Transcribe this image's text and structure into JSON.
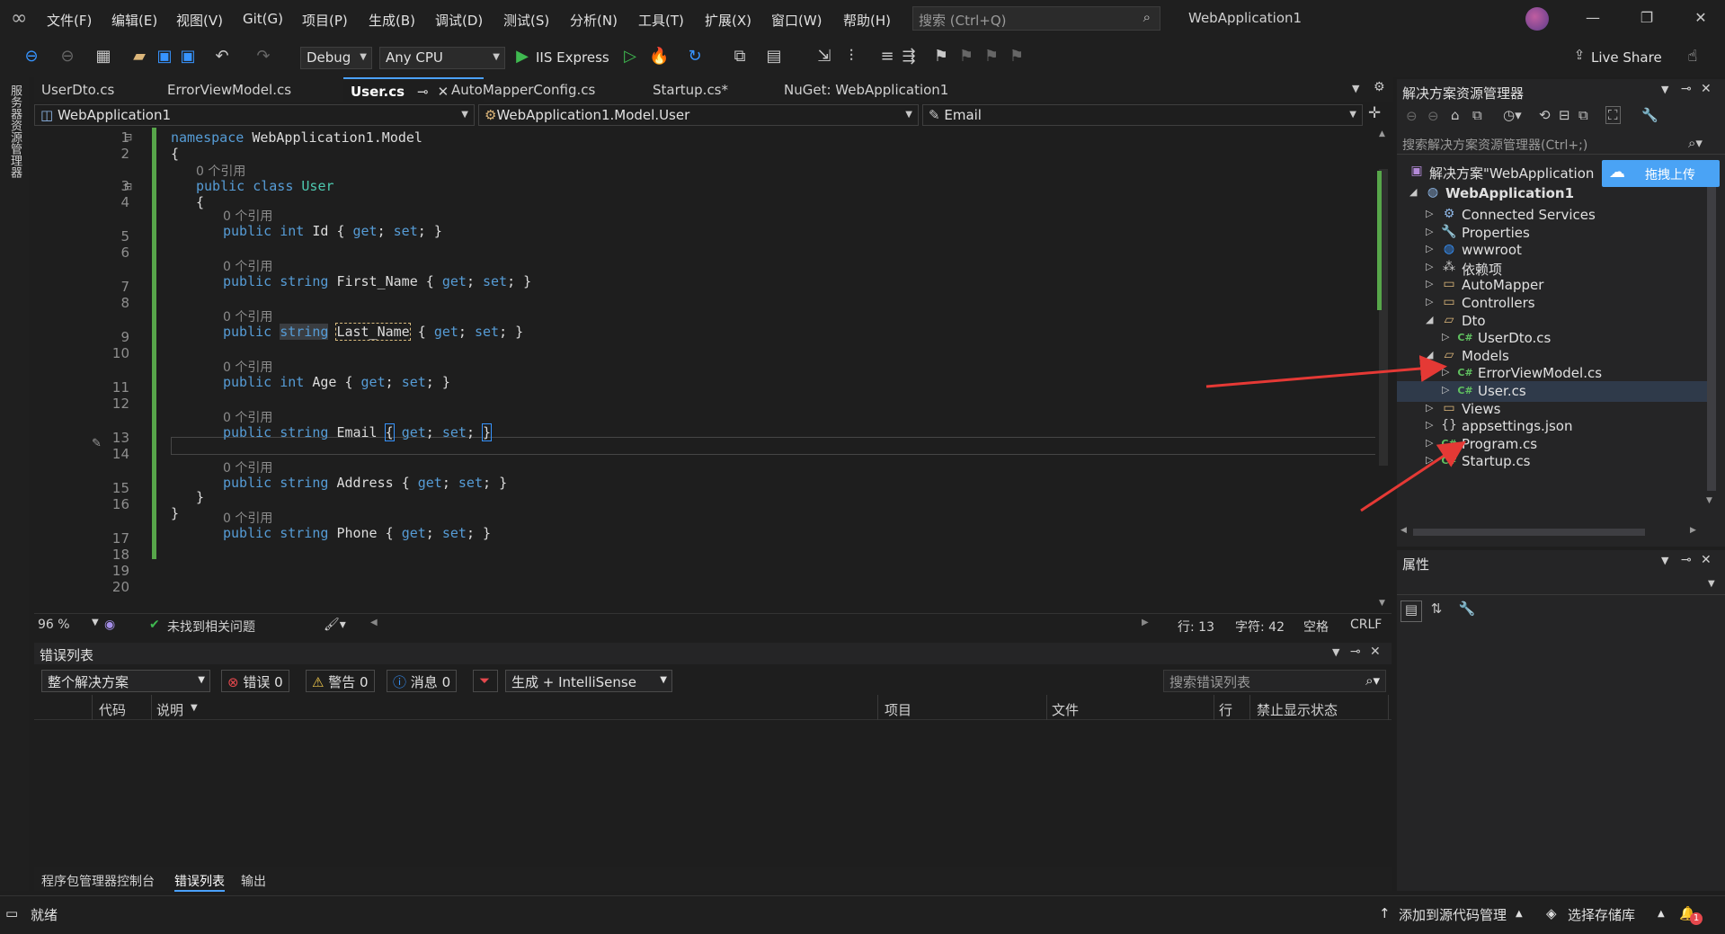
{
  "menubar": {
    "items": [
      "文件(F)",
      "编辑(E)",
      "视图(V)",
      "Git(G)",
      "项目(P)",
      "生成(B)",
      "调试(D)",
      "测试(S)",
      "分析(N)",
      "工具(T)",
      "扩展(X)",
      "窗口(W)",
      "帮助(H)"
    ],
    "search_placeholder": "搜索 (Ctrl+Q)",
    "app_title": "WebApplication1"
  },
  "toolbar": {
    "config": "Debug",
    "platform": "Any CPU",
    "run_label": "IIS Express",
    "live_share": "Live Share"
  },
  "left_strip": {
    "label": "服务器资源管理器"
  },
  "tabs": [
    {
      "label": "UserDto.cs",
      "active": false
    },
    {
      "label": "ErrorViewModel.cs",
      "active": false
    },
    {
      "label": "User.cs",
      "active": true
    },
    {
      "label": "AutoMapperConfig.cs",
      "active": false
    },
    {
      "label": "Startup.cs*",
      "active": false
    },
    {
      "label": "NuGet: WebApplication1",
      "active": false
    }
  ],
  "navbar": {
    "project": "WebApplication1",
    "type": "WebApplication1.Model.User",
    "member": "Email"
  },
  "code": {
    "ref_hint": "0 个引用",
    "line_numbers": [
      "1",
      "2",
      "3",
      "4",
      "5",
      "6",
      "7",
      "8",
      "9",
      "10",
      "11",
      "12",
      "13",
      "14",
      "15",
      "16",
      "17",
      "18",
      "19",
      "20"
    ],
    "namespace_kw": "namespace",
    "namespace_name": "WebApplication1.Model",
    "open_brace": "{",
    "close_brace": "}",
    "class_decl_kw": "public class",
    "class_name": "User",
    "properties": [
      {
        "type": "int",
        "name": "Id"
      },
      {
        "type": "string",
        "name": "First_Name"
      },
      {
        "type": "string",
        "name": "Last_Name"
      },
      {
        "type": "int",
        "name": "Age"
      },
      {
        "type": "string",
        "name": "Email"
      },
      {
        "type": "string",
        "name": "Address"
      },
      {
        "type": "string",
        "name": "Phone"
      }
    ],
    "public_kw": "public",
    "get_kw": "get",
    "set_kw": "set"
  },
  "editor_status": {
    "zoom": "96 %",
    "issues": "未找到相关问题",
    "line": "行: 13",
    "char": "字符: 42",
    "whitespace": "空格",
    "eol": "CRLF"
  },
  "error_list": {
    "title": "错误列表",
    "scope": "整个解决方案",
    "errors": "错误 0",
    "warnings": "警告 0",
    "messages": "消息 0",
    "source": "生成 + IntelliSense",
    "search_placeholder": "搜索错误列表",
    "columns": [
      "代码",
      "说明",
      "项目",
      "文件",
      "行",
      "禁止显示状态"
    ]
  },
  "bottom_tabs": [
    "程序包管理器控制台",
    "错误列表",
    "输出"
  ],
  "solution_explorer": {
    "title": "解决方案资源管理器",
    "search_placeholder": "搜索解决方案资源管理器(Ctrl+;)",
    "solution": "解决方案\"WebApplication",
    "upload_label": "拖拽上传",
    "project": "WebApplication1",
    "items": [
      {
        "label": "Connected Services",
        "icon": "connected-services-icon"
      },
      {
        "label": "Properties",
        "icon": "wrench-icon"
      },
      {
        "label": "wwwroot",
        "icon": "globe-icon"
      },
      {
        "label": "依赖项",
        "icon": "dependencies-icon"
      },
      {
        "label": "AutoMapper",
        "icon": "folder-icon"
      },
      {
        "label": "Controllers",
        "icon": "folder-icon"
      },
      {
        "label": "Dto",
        "icon": "folder-open-icon"
      },
      {
        "label": "UserDto.cs",
        "icon": "csharp-icon"
      },
      {
        "label": "Models",
        "icon": "folder-open-icon"
      },
      {
        "label": "ErrorViewModel.cs",
        "icon": "csharp-icon"
      },
      {
        "label": "User.cs",
        "icon": "csharp-icon"
      },
      {
        "label": "Views",
        "icon": "folder-icon"
      },
      {
        "label": "appsettings.json",
        "icon": "json-icon"
      },
      {
        "label": "Program.cs",
        "icon": "csharp-icon"
      },
      {
        "label": "Startup.cs",
        "icon": "csharp-icon"
      }
    ]
  },
  "properties_panel": {
    "title": "属性"
  },
  "statusbar": {
    "ready": "就绪",
    "add_source": "添加到源代码管理",
    "select_repo": "选择存储库",
    "notifications": "1"
  },
  "colors": {
    "accent": "#4ba1ff",
    "keyword": "#569cd6",
    "type": "#4ec9b0",
    "arrow": "#e53935"
  }
}
